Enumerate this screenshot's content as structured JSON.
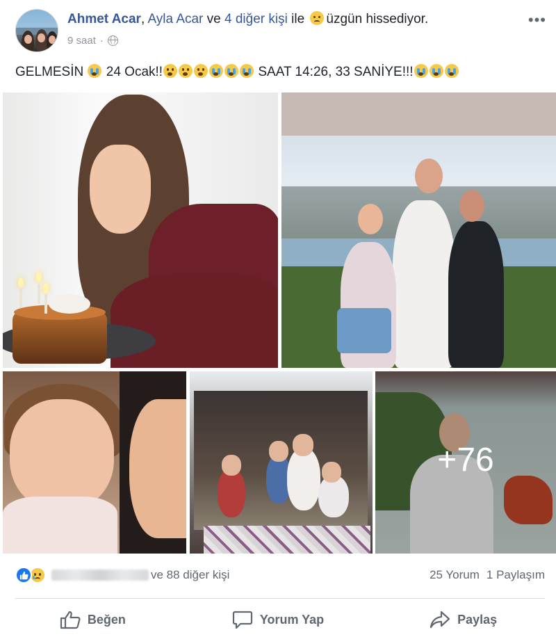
{
  "post": {
    "author": "Ahmet Acar",
    "with_text": ", ",
    "tagged": "Ayla Acar",
    "tagged_connector": " ve ",
    "others": "4 diğer kişi",
    "with_suffix": " ile ",
    "feeling": "üzgün hissediyor.",
    "time": "9 saat",
    "separator": "·",
    "privacy_icon": "globe-icon",
    "more_icon": "•••",
    "status_part1": "GELMESİN",
    "status_part2": "24 Ocak!!",
    "status_part3": "SAAT 14:26, 33 SANİYE!!!",
    "more_photos": "+76"
  },
  "reactions": {
    "types": [
      "like-icon",
      "sad-icon"
    ],
    "others_text": "ve 88 diğer kişi",
    "comments": "25 Yorum",
    "shares": "1 Paylaşım"
  },
  "actions": {
    "like": "Beğen",
    "comment": "Yorum Yap",
    "share": "Paylaş"
  },
  "colors": {
    "link": "#365899",
    "like_blue": "#1877f2",
    "muted": "#606770",
    "meta": "#90949c"
  }
}
